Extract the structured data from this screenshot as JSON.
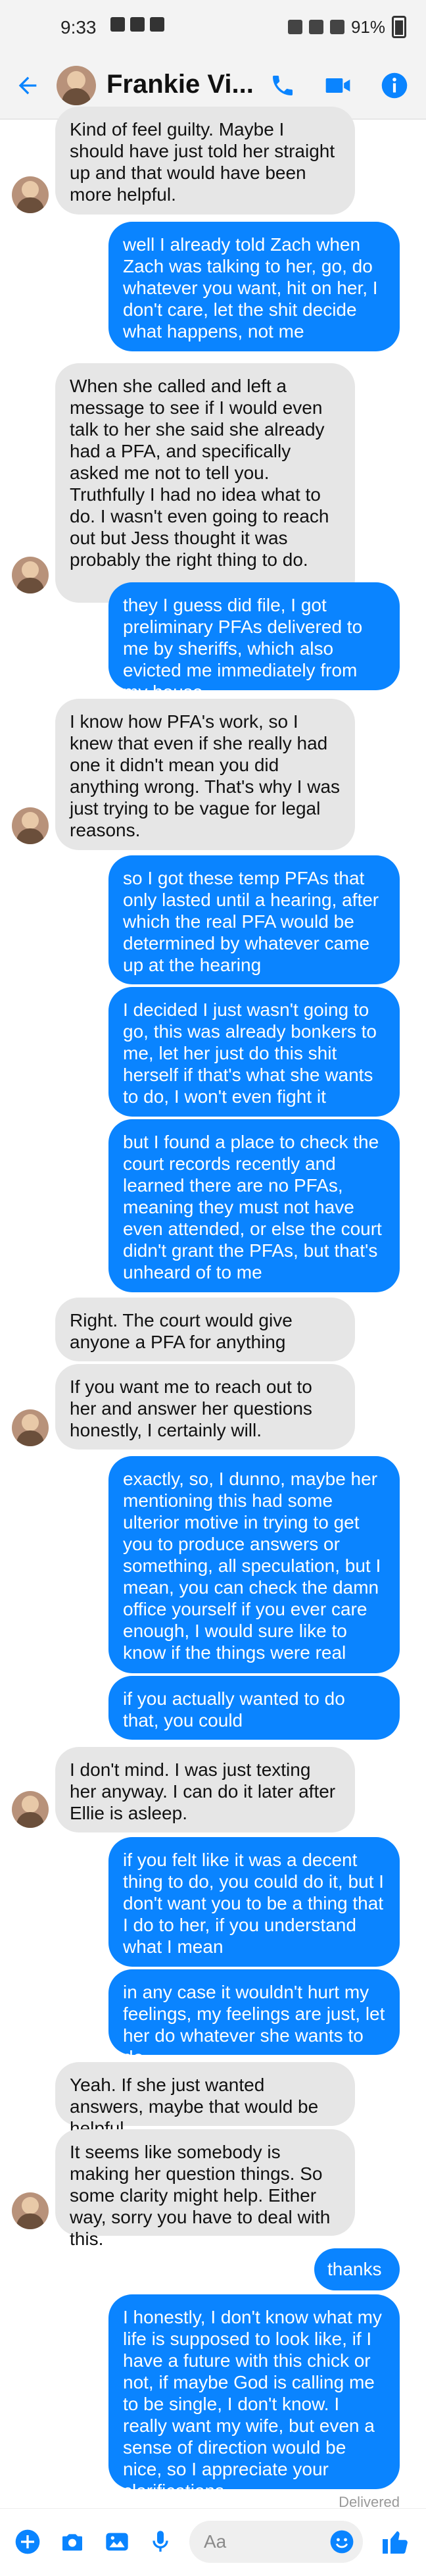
{
  "status_bar": {
    "time": "9:33",
    "battery": "91%",
    "icons": [
      "flash-icon",
      "image-icon",
      "shield-icon",
      "mute-icon",
      "wifi-icon",
      "signal-icon",
      "battery-icon"
    ]
  },
  "header": {
    "contact_name": "Frankie Vi...",
    "back_icon": "arrow-left-icon",
    "call_icon": "phone-icon",
    "video_icon": "video-icon",
    "info_icon": "info-icon",
    "accent_color": "#0a84ff"
  },
  "messages": [
    {
      "sender": "contact",
      "text": "Kind of feel guilty. Maybe I should have just told her straight up and that would have been more helpful."
    },
    {
      "sender": "me",
      "text": "well I already told Zach when Zach was talking to her, go, do whatever you want, hit on her, I don't care, let the shit decide what happens, not me"
    },
    {
      "sender": "contact",
      "text": "When she called and left a message to see if I would even talk to her she said she already had a PFA, and specifically asked me not to tell you. Truthfully I had no idea what to do. I wasn't even going to reach out but Jess thought it was probably the right thing to do."
    },
    {
      "sender": "me",
      "text": "they I guess did file, I got preliminary PFAs delivered to me by sheriffs, which also evicted me immediately from my house"
    },
    {
      "sender": "contact",
      "text": "I know how PFA's work, so I knew that even if she really had one it didn't mean you did anything wrong. That's why I was just trying to be vague for legal reasons."
    },
    {
      "sender": "me",
      "text": "so I got these temp PFAs that only lasted until a hearing, after which the real PFA would be determined by whatever came up at the hearing"
    },
    {
      "sender": "me",
      "text": "I decided I just wasn't going to go, this was already bonkers to me, let her just do this shit herself if that's what she wants to do, I won't even fight it"
    },
    {
      "sender": "me",
      "text": "but I found a place to check the court records recently and learned there are no PFAs, meaning they must not have even attended, or else the court didn't grant the PFAs, but that's unheard of to me"
    },
    {
      "sender": "contact",
      "text": "Right. The court would give anyone a PFA for anything"
    },
    {
      "sender": "contact",
      "text": "If you want me to reach out to her and answer her questions honestly, I certainly will."
    },
    {
      "sender": "me",
      "text": "exactly, so, I dunno, maybe her mentioning this had some ulterior motive in trying to get you to produce answers or something, all speculation, but I mean, you can check the damn office yourself if you ever care enough, I would sure like to know if the things were real"
    },
    {
      "sender": "me",
      "text": "if you actually wanted to do that, you could"
    },
    {
      "sender": "contact",
      "text": "I don't mind. I was just texting her anyway. I can do it later after Ellie is asleep."
    },
    {
      "sender": "me",
      "text": "if you felt like it was a decent thing to do, you could do it, but I don't want you to be a thing that I do to her, if you understand what I mean"
    },
    {
      "sender": "me",
      "text": "in any case it wouldn't hurt my feelings, my feelings are just, let her do whatever she wants to do"
    },
    {
      "sender": "contact",
      "text": "Yeah. If she just wanted answers, maybe that would be helpful."
    },
    {
      "sender": "contact",
      "text": "It seems like somebody is making her question things. So some clarity might help. Either way, sorry you have to deal with this."
    },
    {
      "sender": "me",
      "text": "thanks"
    },
    {
      "sender": "me",
      "text": "I honestly, I don't know what my life is supposed to look like, if I have a future with this chick or not, if maybe God is calling me to be single, I don't know. I really want my wife, but even a sense of direction would be nice, so I appreciate your clarifications"
    }
  ],
  "delivered_label": "Delivered",
  "composer": {
    "placeholder": "Aa",
    "icons": [
      "plus-icon",
      "camera-icon",
      "gallery-icon",
      "mic-icon",
      "emoji-icon",
      "thumbs-up-icon"
    ]
  }
}
